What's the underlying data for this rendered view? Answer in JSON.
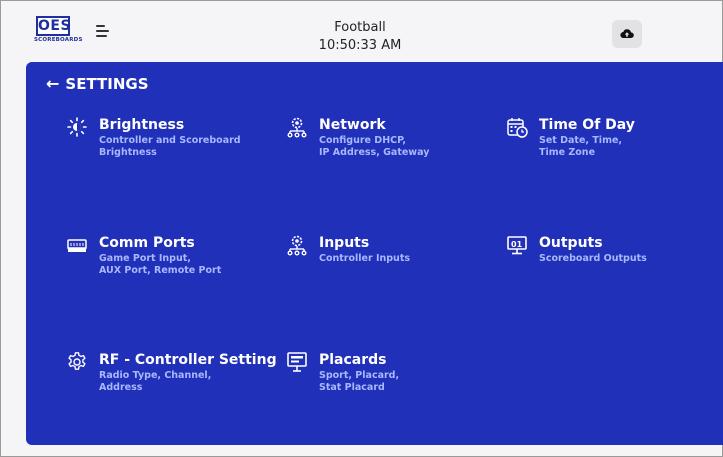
{
  "header": {
    "logo_text": "OES",
    "logo_sub": "SCOREBOARDS",
    "sport": "Football",
    "time": "10:50:33 AM",
    "menu_icon": "menu-icon",
    "cloud_icon": "cloud-upload-icon"
  },
  "settings": {
    "back_label": "SETTINGS",
    "items": [
      {
        "label": "Brightness",
        "line1": "Controller and Scoreboard",
        "line2": "Brightness",
        "icon": "brightness-icon"
      },
      {
        "label": "Network",
        "line1": "Configure DHCP,",
        "line2": "IP Address, Gateway",
        "icon": "network-icon"
      },
      {
        "label": "Time Of Day",
        "line1": "Set Date, Time,",
        "line2": "Time Zone",
        "icon": "calendar-clock-icon"
      },
      {
        "label": "Comm Ports",
        "line1": "Game Port Input,",
        "line2": "AUX Port, Remote Port",
        "icon": "comm-port-icon"
      },
      {
        "label": "Inputs",
        "line1": "Controller Inputs",
        "line2": "",
        "icon": "inputs-icon"
      },
      {
        "label": "Outputs",
        "line1": "Scoreboard Outputs",
        "line2": "",
        "icon": "scoreboard-output-icon"
      },
      {
        "label": "RF - Controller Setting",
        "line1": "Radio Type, Channel,",
        "line2": "Address",
        "icon": "gear-icon"
      },
      {
        "label": "Placards",
        "line1": "Sport, Placard,",
        "line2": "Stat Placard",
        "icon": "placard-icon"
      }
    ]
  },
  "colors": {
    "panel": "#2130b8",
    "description": "#a8b8ff",
    "logo": "#1f2f9e"
  }
}
